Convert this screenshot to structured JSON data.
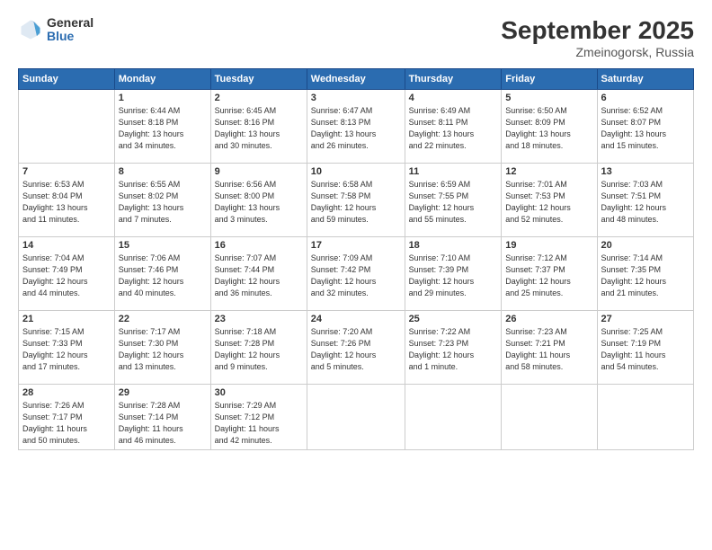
{
  "header": {
    "logo_general": "General",
    "logo_blue": "Blue",
    "month_title": "September 2025",
    "location": "Zmeinogorsk, Russia"
  },
  "calendar": {
    "days_of_week": [
      "Sunday",
      "Monday",
      "Tuesday",
      "Wednesday",
      "Thursday",
      "Friday",
      "Saturday"
    ],
    "weeks": [
      [
        {
          "day": "",
          "info": ""
        },
        {
          "day": "1",
          "info": "Sunrise: 6:44 AM\nSunset: 8:18 PM\nDaylight: 13 hours\nand 34 minutes."
        },
        {
          "day": "2",
          "info": "Sunrise: 6:45 AM\nSunset: 8:16 PM\nDaylight: 13 hours\nand 30 minutes."
        },
        {
          "day": "3",
          "info": "Sunrise: 6:47 AM\nSunset: 8:13 PM\nDaylight: 13 hours\nand 26 minutes."
        },
        {
          "day": "4",
          "info": "Sunrise: 6:49 AM\nSunset: 8:11 PM\nDaylight: 13 hours\nand 22 minutes."
        },
        {
          "day": "5",
          "info": "Sunrise: 6:50 AM\nSunset: 8:09 PM\nDaylight: 13 hours\nand 18 minutes."
        },
        {
          "day": "6",
          "info": "Sunrise: 6:52 AM\nSunset: 8:07 PM\nDaylight: 13 hours\nand 15 minutes."
        }
      ],
      [
        {
          "day": "7",
          "info": "Sunrise: 6:53 AM\nSunset: 8:04 PM\nDaylight: 13 hours\nand 11 minutes."
        },
        {
          "day": "8",
          "info": "Sunrise: 6:55 AM\nSunset: 8:02 PM\nDaylight: 13 hours\nand 7 minutes."
        },
        {
          "day": "9",
          "info": "Sunrise: 6:56 AM\nSunset: 8:00 PM\nDaylight: 13 hours\nand 3 minutes."
        },
        {
          "day": "10",
          "info": "Sunrise: 6:58 AM\nSunset: 7:58 PM\nDaylight: 12 hours\nand 59 minutes."
        },
        {
          "day": "11",
          "info": "Sunrise: 6:59 AM\nSunset: 7:55 PM\nDaylight: 12 hours\nand 55 minutes."
        },
        {
          "day": "12",
          "info": "Sunrise: 7:01 AM\nSunset: 7:53 PM\nDaylight: 12 hours\nand 52 minutes."
        },
        {
          "day": "13",
          "info": "Sunrise: 7:03 AM\nSunset: 7:51 PM\nDaylight: 12 hours\nand 48 minutes."
        }
      ],
      [
        {
          "day": "14",
          "info": "Sunrise: 7:04 AM\nSunset: 7:49 PM\nDaylight: 12 hours\nand 44 minutes."
        },
        {
          "day": "15",
          "info": "Sunrise: 7:06 AM\nSunset: 7:46 PM\nDaylight: 12 hours\nand 40 minutes."
        },
        {
          "day": "16",
          "info": "Sunrise: 7:07 AM\nSunset: 7:44 PM\nDaylight: 12 hours\nand 36 minutes."
        },
        {
          "day": "17",
          "info": "Sunrise: 7:09 AM\nSunset: 7:42 PM\nDaylight: 12 hours\nand 32 minutes."
        },
        {
          "day": "18",
          "info": "Sunrise: 7:10 AM\nSunset: 7:39 PM\nDaylight: 12 hours\nand 29 minutes."
        },
        {
          "day": "19",
          "info": "Sunrise: 7:12 AM\nSunset: 7:37 PM\nDaylight: 12 hours\nand 25 minutes."
        },
        {
          "day": "20",
          "info": "Sunrise: 7:14 AM\nSunset: 7:35 PM\nDaylight: 12 hours\nand 21 minutes."
        }
      ],
      [
        {
          "day": "21",
          "info": "Sunrise: 7:15 AM\nSunset: 7:33 PM\nDaylight: 12 hours\nand 17 minutes."
        },
        {
          "day": "22",
          "info": "Sunrise: 7:17 AM\nSunset: 7:30 PM\nDaylight: 12 hours\nand 13 minutes."
        },
        {
          "day": "23",
          "info": "Sunrise: 7:18 AM\nSunset: 7:28 PM\nDaylight: 12 hours\nand 9 minutes."
        },
        {
          "day": "24",
          "info": "Sunrise: 7:20 AM\nSunset: 7:26 PM\nDaylight: 12 hours\nand 5 minutes."
        },
        {
          "day": "25",
          "info": "Sunrise: 7:22 AM\nSunset: 7:23 PM\nDaylight: 12 hours\nand 1 minute."
        },
        {
          "day": "26",
          "info": "Sunrise: 7:23 AM\nSunset: 7:21 PM\nDaylight: 11 hours\nand 58 minutes."
        },
        {
          "day": "27",
          "info": "Sunrise: 7:25 AM\nSunset: 7:19 PM\nDaylight: 11 hours\nand 54 minutes."
        }
      ],
      [
        {
          "day": "28",
          "info": "Sunrise: 7:26 AM\nSunset: 7:17 PM\nDaylight: 11 hours\nand 50 minutes."
        },
        {
          "day": "29",
          "info": "Sunrise: 7:28 AM\nSunset: 7:14 PM\nDaylight: 11 hours\nand 46 minutes."
        },
        {
          "day": "30",
          "info": "Sunrise: 7:29 AM\nSunset: 7:12 PM\nDaylight: 11 hours\nand 42 minutes."
        },
        {
          "day": "",
          "info": ""
        },
        {
          "day": "",
          "info": ""
        },
        {
          "day": "",
          "info": ""
        },
        {
          "day": "",
          "info": ""
        }
      ]
    ]
  }
}
